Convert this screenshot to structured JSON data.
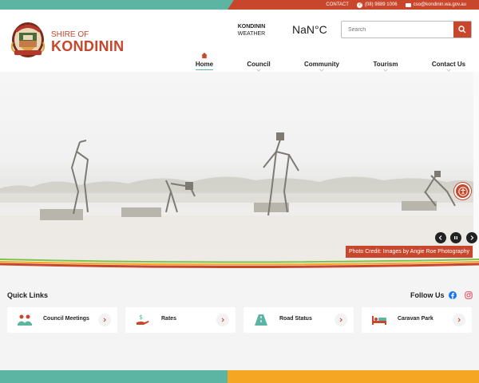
{
  "topbar": {
    "contact_label": "CONTACT",
    "phone": "(08) 9889 1006",
    "email": "cso@kondinin.wa.gov.au"
  },
  "logo": {
    "line1": "SHIRE OF",
    "line2": "KONDININ"
  },
  "weather": {
    "label_line1": "KONDININ",
    "label_line2": "WEATHER",
    "temperature": "NaN°C"
  },
  "search": {
    "placeholder": "Search"
  },
  "nav": {
    "items": [
      {
        "label": "Home"
      },
      {
        "label": "Council"
      },
      {
        "label": "Community"
      },
      {
        "label": "Tourism"
      },
      {
        "label": "Contact Us"
      }
    ]
  },
  "hero": {
    "photo_credit": "Photo Credit: Images by Angie Roe Photography"
  },
  "quick_links": {
    "title": "Quick Links",
    "follow_label": "Follow Us",
    "cards": [
      {
        "label": "Council Meetings",
        "icon": "people-icon"
      },
      {
        "label": "Rates",
        "icon": "hand-money-icon"
      },
      {
        "label": "Road Status",
        "icon": "road-icon"
      },
      {
        "label": "Caravan Park",
        "icon": "bed-icon"
      }
    ]
  },
  "colors": {
    "brand_red": "#c8462b",
    "teal": "#5bb5a2",
    "orange": "#f5a623"
  }
}
